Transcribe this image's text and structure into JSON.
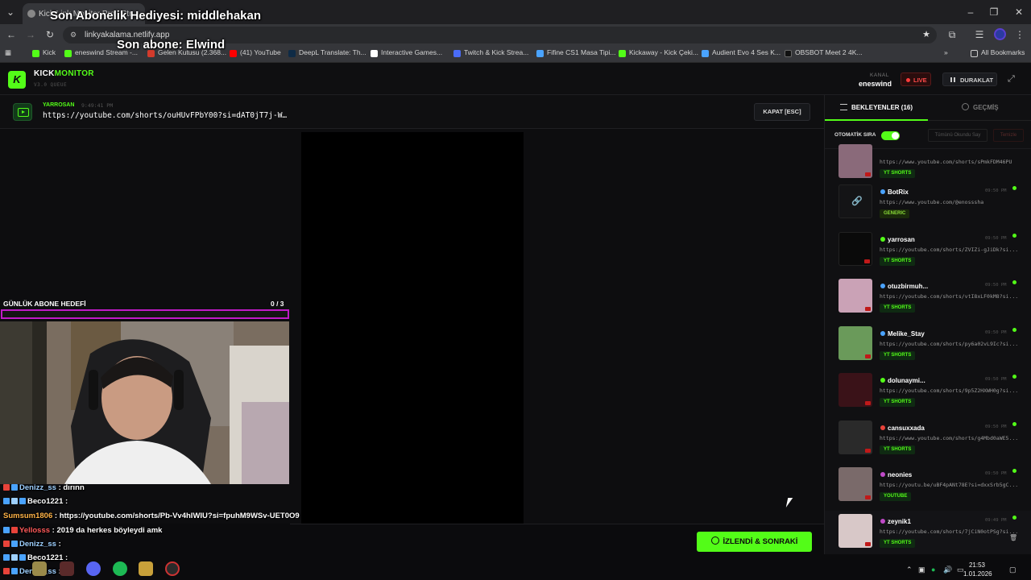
{
  "browser": {
    "tab_title": "Kick Link Monitor Pro | Str...",
    "url": "linkyakalama.netlify.app",
    "bookmarks": [
      {
        "label": "Kick",
        "color": "#53fc18"
      },
      {
        "label": "eneswind Stream -...",
        "color": "#53fc18"
      },
      {
        "label": "Gelen Kutusu (2.368...",
        "color": "#d33b2c"
      },
      {
        "label": "(41) YouTube",
        "color": "#ff0000"
      },
      {
        "label": "DeepL Translate: Th...",
        "color": "#0f2b46"
      },
      {
        "label": "Interactive Games...",
        "color": "#ffffff"
      },
      {
        "label": "Twitch & Kick Strea...",
        "color": "#4a6cf7"
      },
      {
        "label": "Fifine CS1 Masa Tipi...",
        "color": "#4aa3ff"
      },
      {
        "label": "Kickaway - Kick Çeki...",
        "color": "#53fc18"
      },
      {
        "label": "Audient Evo 4 Ses K...",
        "color": "#4aa3ff"
      },
      {
        "label": "OBSBOT Meet 2 4K...",
        "color": "#111111"
      }
    ],
    "all_bookmarks": "All Bookmarks"
  },
  "overlay": {
    "gift_text": "Son Abonelik Hediyesi: middlehakan",
    "sub_text": "Son abone: Elwind"
  },
  "app": {
    "brand_kick": "KICK",
    "brand_monitor": "MONITOR",
    "version": "V3.0 QUEUE",
    "logo_letter": "K",
    "channel_label": "KANAL",
    "channel_name": "eneswind",
    "live_label": "LIVE",
    "pause_label": "DURAKLAT",
    "accent": "#53fc18"
  },
  "now_playing": {
    "user": "YARROSAN",
    "time": "9:49:41 PM",
    "url": "https://youtube.com/shorts/ouHUvFPbY00?si=dAT0jT7j-W…",
    "close_label": "KAPAT [ESC]"
  },
  "goal": {
    "label": "GÜNLÜK ABONE HEDEFİ",
    "current": 0,
    "target": 3,
    "count_text": "0  / 3"
  },
  "chat": [
    {
      "user": "Denizz_ss",
      "msg": ": dırınn",
      "color": "#9ed0ff",
      "badges": [
        "#e8433a",
        "#4aa3ff"
      ]
    },
    {
      "user": "Beco1221",
      "msg": ":",
      "color": "#ffffff",
      "badges": [
        "#4aa3ff",
        "#9ed0ff",
        "#4aa3ff"
      ]
    },
    {
      "user": "Sumsum1806",
      "msg": ": https://youtube.com/shorts/Pb-Vv4hIWIU?si=fpuhM9WSv-UET0O9",
      "color": "#ffb347",
      "badges": []
    },
    {
      "user": "Yellosss",
      "msg": ": 2019 da herkes böyleydi amk",
      "color": "#ff5a5a",
      "badges": [
        "#4aa3ff",
        "#e8433a"
      ]
    },
    {
      "user": "Denizz_ss",
      "msg": ":",
      "color": "#9ed0ff",
      "badges": [
        "#e8433a",
        "#4aa3ff"
      ]
    },
    {
      "user": "Beco1221",
      "msg": ":",
      "color": "#ffffff",
      "badges": [
        "#4aa3ff",
        "#9ed0ff",
        "#4aa3ff"
      ]
    },
    {
      "user": "Denizz_ss",
      "msg": ":",
      "color": "#9ed0ff",
      "badges": [
        "#e8433a",
        "#4aa3ff"
      ]
    }
  ],
  "next_button": "İZLENDİ & SONRAKİ",
  "queue_panel": {
    "tab_pending": "BEKLEYENLER (16)",
    "tab_history": "GEÇMİŞ",
    "auto_label": "OTOMATİK SIRA",
    "auto_on": true,
    "mark_all": "Tümünü Okundu Say",
    "clear": "Temizle",
    "items": [
      {
        "user": "",
        "time": "",
        "url": "https://www.youtube.com/shorts/sPmkFDM46PU",
        "tag": "YT SHORTS",
        "dot": "#4aa3ff",
        "thumb": "#8a6a7a"
      },
      {
        "user": "BotRix",
        "time": "09:50 PM",
        "url": "https://www.youtube.com/@enosssha",
        "tag": "GENERIC",
        "dot": "#4aa3ff",
        "thumb": "#121214"
      },
      {
        "user": "yarrosan",
        "time": "09:50 PM",
        "url": "https://youtube.com/shorts/ZVIZi-gJiDk?si...",
        "tag": "YT SHORTS",
        "dot": "#53fc18",
        "thumb": "#0a0a0a"
      },
      {
        "user": "otuzbirmuh...",
        "time": "09:50 PM",
        "url": "https://youtube.com/shorts/vtI8xLF0kM8?si...",
        "tag": "YT SHORTS",
        "dot": "#4aa3ff",
        "thumb": "#caa2b6"
      },
      {
        "user": "Melike_Stay",
        "time": "09:50 PM",
        "url": "https://youtube.com/shorts/py6a02vL9Ic?si...",
        "tag": "YT SHORTS",
        "dot": "#4aa3ff",
        "thumb": "#6a9a5a"
      },
      {
        "user": "dolunaymi...",
        "time": "09:50 PM",
        "url": "https://youtube.com/shorts/9p5Z2HXWH0g?si...",
        "tag": "YT SHORTS",
        "dot": "#53fc18",
        "thumb": "#3a1218"
      },
      {
        "user": "cansuxxada",
        "time": "09:50 PM",
        "url": "https://www.youtube.com/shorts/g4Mbd0aWE5...",
        "tag": "YT SHORTS",
        "dot": "#e8433a",
        "thumb": "#2a2a2a"
      },
      {
        "user": "neonies",
        "time": "09:50 PM",
        "url": "https://youtu.be/uBF4pANt78E?si=dxxSrb5gC...",
        "tag": "YOUTUBE",
        "dot": "#c04ac8",
        "thumb": "#7a6a6a"
      },
      {
        "user": "zeynik1",
        "time": "09:49 PM",
        "url": "https://youtube.com/shorts/7jCiN0otPSg?si...",
        "tag": "YT SHORTS",
        "dot": "#c04ac8",
        "thumb": "#d8c8c8"
      }
    ]
  },
  "taskbar": {
    "time": "21:53",
    "date": "1.01.2026"
  }
}
